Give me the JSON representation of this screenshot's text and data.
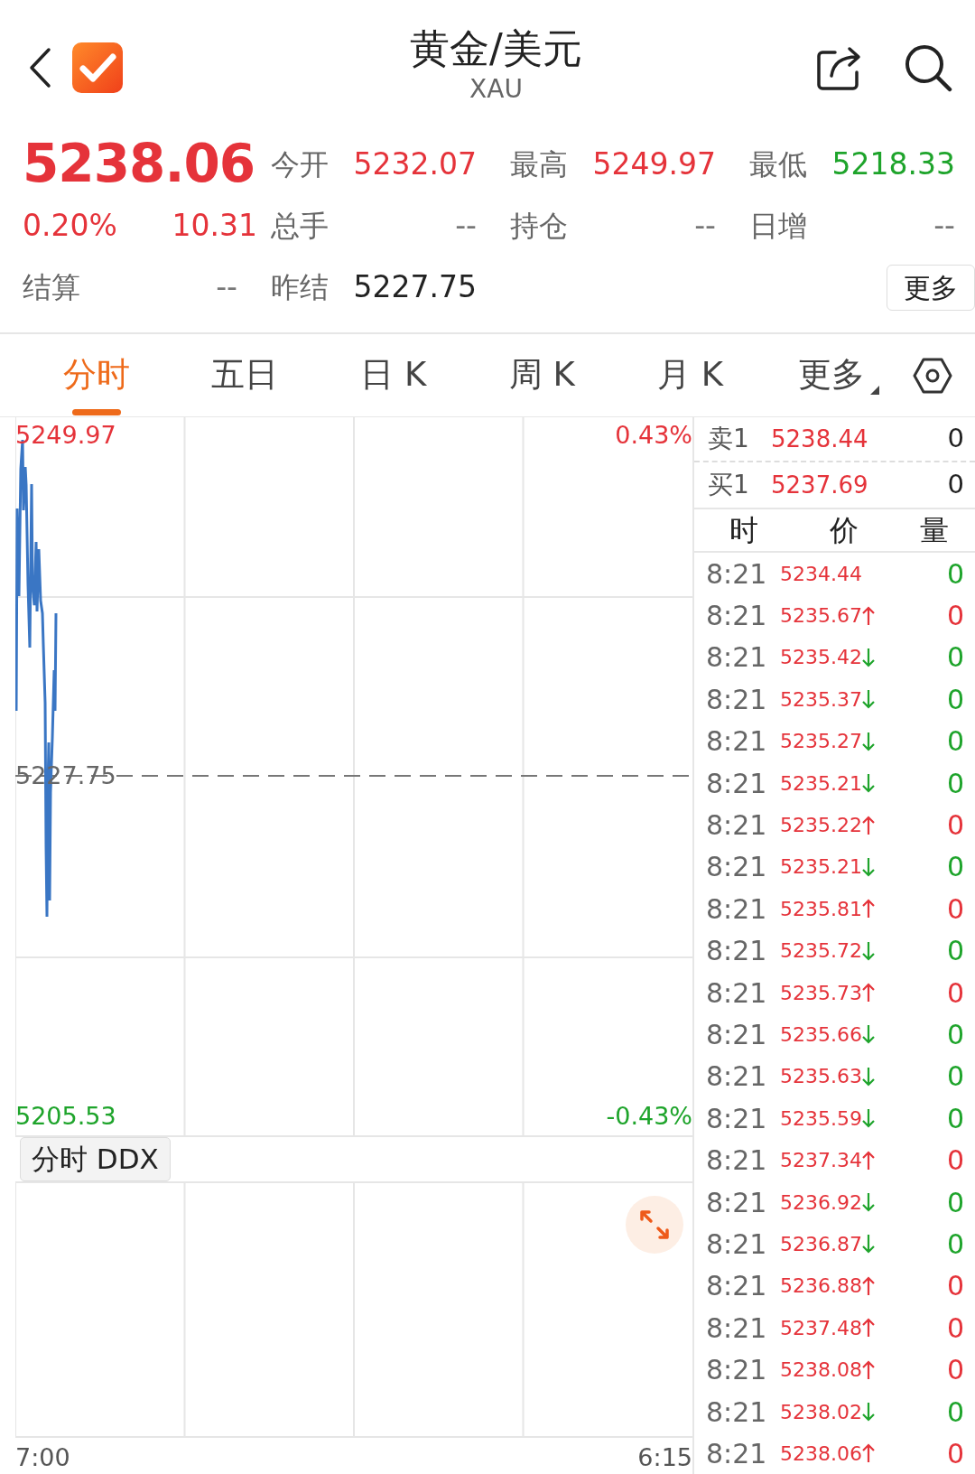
{
  "header": {
    "title": "黄金/美元",
    "subtitle": "XAU"
  },
  "quote": {
    "price": "5238.06",
    "change_pct": "0.20%",
    "change": "10.31",
    "color": "#e5333a"
  },
  "stats": [
    {
      "label": "今开",
      "value": "5232.07",
      "color": "#e5333a"
    },
    {
      "label": "最高",
      "value": "5249.97",
      "color": "#e5333a"
    },
    {
      "label": "最低",
      "value": "5218.33",
      "color": "#1ea42b"
    },
    {
      "label": "总手",
      "value": "--",
      "color": "#777777"
    },
    {
      "label": "持仓",
      "value": "--",
      "color": "#777777"
    },
    {
      "label": "日增",
      "value": "--",
      "color": "#777777"
    },
    {
      "label": "结算",
      "value": "--",
      "color": "#777777"
    },
    {
      "label": "昨结",
      "value": "5227.75",
      "color": "#222222"
    }
  ],
  "more_button": "更多",
  "tabs": [
    {
      "label": "分时",
      "selected": true,
      "kind": "tab"
    },
    {
      "label": "五日",
      "selected": false,
      "kind": "tab"
    },
    {
      "label": "日 K",
      "selected": false,
      "kind": "tab"
    },
    {
      "label": "周 K",
      "selected": false,
      "kind": "tab"
    },
    {
      "label": "月 K",
      "selected": false,
      "kind": "tab"
    },
    {
      "label": "更多",
      "selected": false,
      "kind": "dropdown"
    }
  ],
  "chart": {
    "y_max": "5249.97",
    "y_max_pct": "0.43%",
    "y_ref": "5227.75",
    "y_min": "5205.53",
    "y_min_pct": "-0.43%",
    "time_start": "7:00",
    "time_end": "6:15"
  },
  "indicator": {
    "label": "分时 DDX"
  },
  "order_book": [
    {
      "side": "卖1",
      "price": "5238.44",
      "volume": "0"
    },
    {
      "side": "买1",
      "price": "5237.69",
      "volume": "0"
    }
  ],
  "trades_header": [
    "时",
    "价",
    "量"
  ],
  "trades": [
    {
      "time": "8:21",
      "price": "5234.44",
      "kind": "flat",
      "volume": "0",
      "color": "#1ea42b"
    },
    {
      "time": "8:21",
      "price": "5235.67",
      "kind": "uptick",
      "volume": "0",
      "color": "#e5333a"
    },
    {
      "time": "8:21",
      "price": "5235.42",
      "kind": "downtick",
      "volume": "0",
      "color": "#1ea42b"
    },
    {
      "time": "8:21",
      "price": "5235.37",
      "kind": "downtick",
      "volume": "0",
      "color": "#1ea42b"
    },
    {
      "time": "8:21",
      "price": "5235.27",
      "kind": "downtick",
      "volume": "0",
      "color": "#1ea42b"
    },
    {
      "time": "8:21",
      "price": "5235.21",
      "kind": "downtick",
      "volume": "0",
      "color": "#1ea42b"
    },
    {
      "time": "8:21",
      "price": "5235.22",
      "kind": "uptick",
      "volume": "0",
      "color": "#e5333a"
    },
    {
      "time": "8:21",
      "price": "5235.21",
      "kind": "downtick",
      "volume": "0",
      "color": "#1ea42b"
    },
    {
      "time": "8:21",
      "price": "5235.81",
      "kind": "uptick",
      "volume": "0",
      "color": "#e5333a"
    },
    {
      "time": "8:21",
      "price": "5235.72",
      "kind": "downtick",
      "volume": "0",
      "color": "#1ea42b"
    },
    {
      "time": "8:21",
      "price": "5235.73",
      "kind": "uptick",
      "volume": "0",
      "color": "#e5333a"
    },
    {
      "time": "8:21",
      "price": "5235.66",
      "kind": "downtick",
      "volume": "0",
      "color": "#1ea42b"
    },
    {
      "time": "8:21",
      "price": "5235.63",
      "kind": "downtick",
      "volume": "0",
      "color": "#1ea42b"
    },
    {
      "time": "8:21",
      "price": "5235.59",
      "kind": "downtick",
      "volume": "0",
      "color": "#1ea42b"
    },
    {
      "time": "8:21",
      "price": "5237.34",
      "kind": "uptick",
      "volume": "0",
      "color": "#e5333a"
    },
    {
      "time": "8:21",
      "price": "5236.92",
      "kind": "downtick",
      "volume": "0",
      "color": "#1ea42b"
    },
    {
      "time": "8:21",
      "price": "5236.87",
      "kind": "downtick",
      "volume": "0",
      "color": "#1ea42b"
    },
    {
      "time": "8:21",
      "price": "5236.88",
      "kind": "uptick",
      "volume": "0",
      "color": "#e5333a"
    },
    {
      "time": "8:21",
      "price": "5237.48",
      "kind": "uptick",
      "volume": "0",
      "color": "#e5333a"
    },
    {
      "time": "8:21",
      "price": "5238.08",
      "kind": "uptick",
      "volume": "0",
      "color": "#e5333a"
    },
    {
      "time": "8:21",
      "price": "5238.02",
      "kind": "downtick",
      "volume": "0",
      "color": "#1ea42b"
    },
    {
      "time": "8:21",
      "price": "5238.06",
      "kind": "uptick",
      "volume": "0",
      "color": "#e5333a"
    }
  ]
}
